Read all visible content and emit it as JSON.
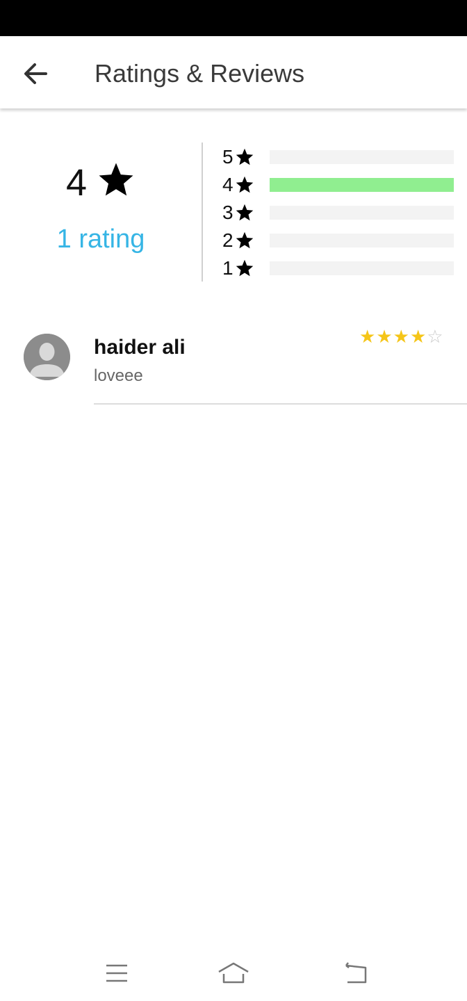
{
  "header": {
    "title": "Ratings & Reviews",
    "back_icon": "arrow-left-icon"
  },
  "summary": {
    "average": "4",
    "rating_count_label": "1 rating",
    "accent_color": "#36b5e5",
    "bar_color": "#90ee90",
    "distribution": [
      {
        "label": "5",
        "fraction": 0
      },
      {
        "label": "4",
        "fraction": 1
      },
      {
        "label": "3",
        "fraction": 0
      },
      {
        "label": "2",
        "fraction": 0
      },
      {
        "label": "1",
        "fraction": 0
      }
    ]
  },
  "reviews": [
    {
      "name": "haider ali",
      "text": "loveee",
      "stars": 4,
      "max_stars": 5,
      "star_color": "#f5c518"
    }
  ],
  "nav": {
    "icons": [
      "menu-icon",
      "home-icon",
      "back-icon"
    ]
  }
}
